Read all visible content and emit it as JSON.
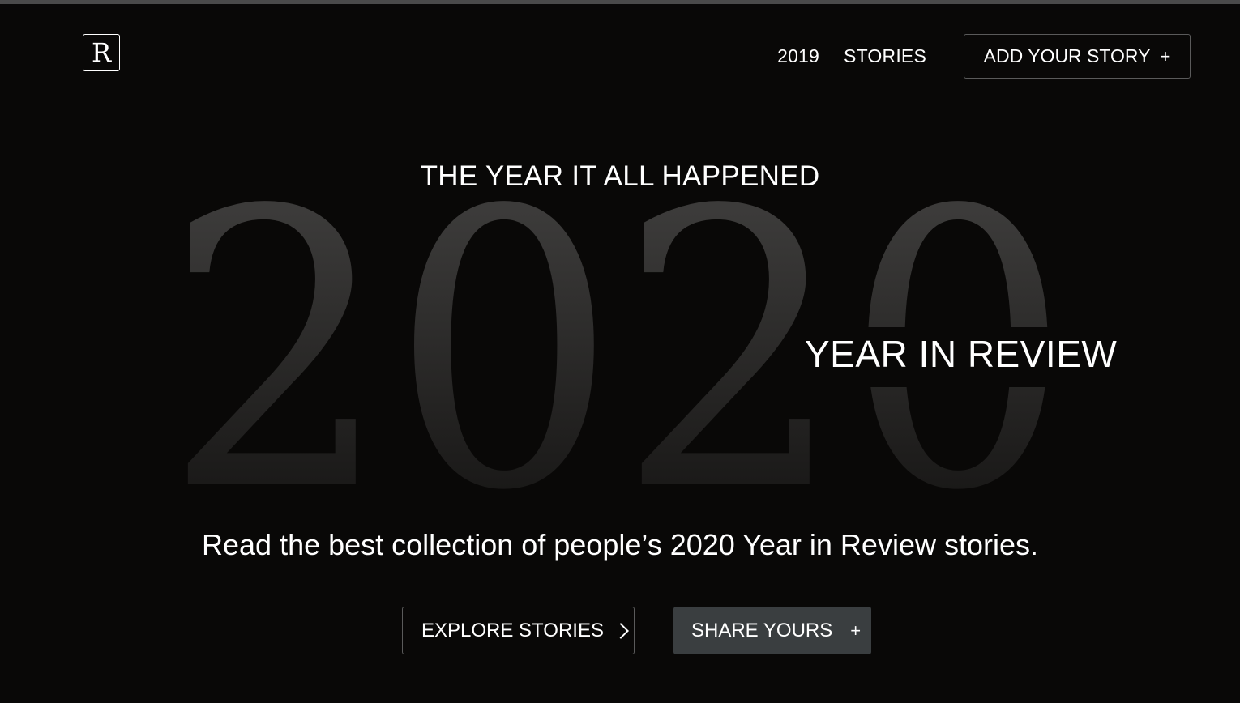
{
  "header": {
    "logo_letter": "R",
    "nav": [
      {
        "label": "2019"
      },
      {
        "label": "STORIES"
      }
    ],
    "cta_label": "ADD YOUR STORY",
    "cta_icon": "+"
  },
  "hero": {
    "tagline": "THE YEAR IT ALL HAPPENED",
    "big_year": "2020",
    "subtitle": "YEAR IN REVIEW",
    "description": "Read the best collection of people’s 2020 Year in Review stories."
  },
  "actions": {
    "explore_label": "EXPLORE STORIES",
    "share_label": "SHARE YOURS",
    "share_icon": "+"
  },
  "colors": {
    "background": "#090807",
    "numeral_top": "#3c3b3a",
    "numeral_bottom": "#1a1918",
    "share_button_bg": "#3a3e40"
  }
}
